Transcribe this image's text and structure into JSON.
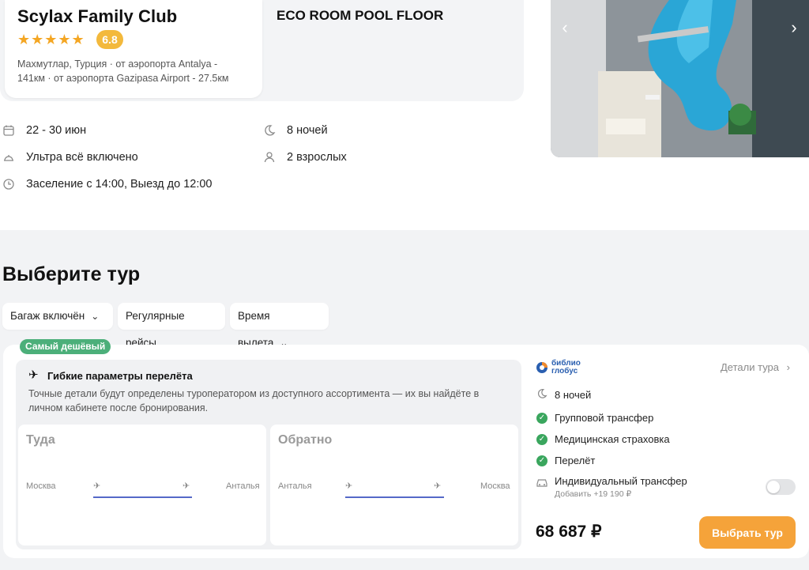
{
  "hotel": {
    "name": "Scylax Family Club",
    "stars": "★★★★★",
    "rating": "6.8",
    "location_line1": "Махмутлар, Турция · от аэропорта Antalya -",
    "location_line2": "141км · от аэропорта Gazipasa Airport - 27.5км",
    "room": "ECO ROOM POOL FLOOR"
  },
  "gallery": {
    "prev": "‹",
    "next": "›"
  },
  "trip": {
    "dates": "22 - 30 июн",
    "nights": "8 ночей",
    "meal": "Ультра всё включено",
    "guests": "2 взрослых",
    "checkin": "Заселение с 14:00, Выезд до 12:00"
  },
  "section": {
    "title": "Выберите тур"
  },
  "filters": [
    {
      "label": "Багаж включён"
    },
    {
      "label": "Регулярные рейсы"
    },
    {
      "label": "Время вылета"
    }
  ],
  "offer": {
    "badge": "Самый дешёвый",
    "flight_title": "Гибкие параметры перелёта",
    "flight_desc": "Точные детали будут определены туроператором из доступного ассортимента — их вы найдёте в личном кабинете после бронирования.",
    "outbound": {
      "title": "Туда",
      "from": "Москва",
      "to": "Анталья"
    },
    "inbound": {
      "title": "Обратно",
      "from": "Анталья",
      "to": "Москва"
    },
    "operator": {
      "line1": "библио",
      "line2": "глобус"
    },
    "details_link": "Детали тура",
    "nights": "8 ночей",
    "included": [
      "Групповой трансфер",
      "Медицинская страховка",
      "Перелёт"
    ],
    "optional": {
      "label": "Индивидуальный трансфер",
      "price": "Добавить +19 190 ₽",
      "enabled": false
    },
    "price": "68 687 ₽",
    "cta": "Выбрать тур"
  },
  "colors": {
    "accent": "#f5a33a",
    "badge": "#4caf7a",
    "check": "#3aa65e",
    "stars": "#f4a623",
    "rating": "#f3b93c",
    "route_line": "#5569c8"
  }
}
